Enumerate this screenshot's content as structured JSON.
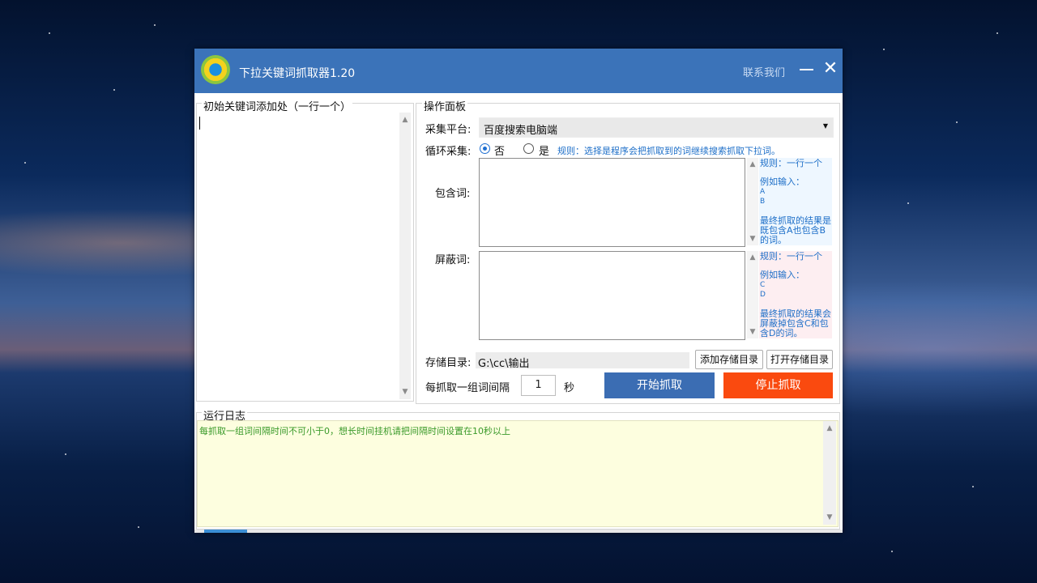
{
  "window": {
    "title": "下拉关键词抓取器1.20",
    "contact_label": "联系我们"
  },
  "left_panel": {
    "title": "初始关键词添加处（一行一个）"
  },
  "ops_panel": {
    "title": "操作面板",
    "platform_label": "采集平台:",
    "platform_value": "百度搜索电脑端",
    "loop_label": "循环采集:",
    "loop_options": [
      {
        "label": "否",
        "selected": true
      },
      {
        "label": "是",
        "selected": false
      }
    ],
    "loop_rule": "规则：选择是程序会把抓取到的词继续搜索抓取下拉词。",
    "include_label": "包含词:",
    "include_hint": {
      "rule": "规则：一行一个",
      "example_title": "例如输入：",
      "example_a": "A",
      "example_b": "B",
      "result": "最终抓取的结果是既包含A也包含B的词。"
    },
    "exclude_label": "屏蔽词:",
    "exclude_hint": {
      "rule": "规则：一行一个",
      "example_title": "例如输入：",
      "example_a": "C",
      "example_b": "D",
      "result": "最终抓取的结果会屏蔽掉包含C和包含D的词。"
    },
    "storage_label": "存储目录:",
    "storage_path": "G:\\cc\\输出",
    "add_dir_button": "添加存储目录",
    "open_dir_button": "打开存储目录",
    "interval_label": "每抓取一组词间隔",
    "interval_value": "1",
    "interval_unit": "秒",
    "start_button": "开始抓取",
    "stop_button": "停止抓取"
  },
  "log_panel": {
    "title": "运行日志",
    "lines": [
      "每抓取一组词间隔时间不可小于0，想长时间挂机请把间隔时间设置在10秒以上"
    ]
  },
  "colors": {
    "titlebar": "#3b73b9",
    "start_button": "#3b6db3",
    "stop_button": "#fa4a0f",
    "hint_text": "#1e6fc8",
    "log_text": "#3a9a2a"
  }
}
